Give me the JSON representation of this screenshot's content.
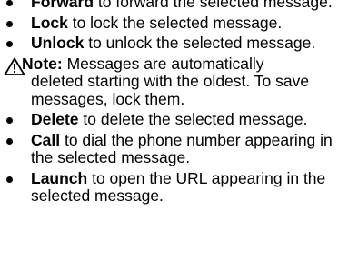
{
  "items": [
    {
      "term": "Forward",
      "text": " to forward the selected message."
    },
    {
      "term": "Lock",
      "text": " to lock the selected message."
    },
    {
      "term": "Unlock",
      "text": " to unlock the selected message."
    }
  ],
  "note": {
    "label": "Note:",
    "line1": " Messages are automatically",
    "line2": "deleted starting with the oldest. To save",
    "line3": "messages, lock them."
  },
  "items2": [
    {
      "term": "Delete",
      "text": " to delete the selected message."
    },
    {
      "term": "Call",
      "text": " to dial the phone number appearing in the selected message."
    },
    {
      "term": "Launch",
      "text": " to open the URL appearing in the selected message."
    }
  ]
}
